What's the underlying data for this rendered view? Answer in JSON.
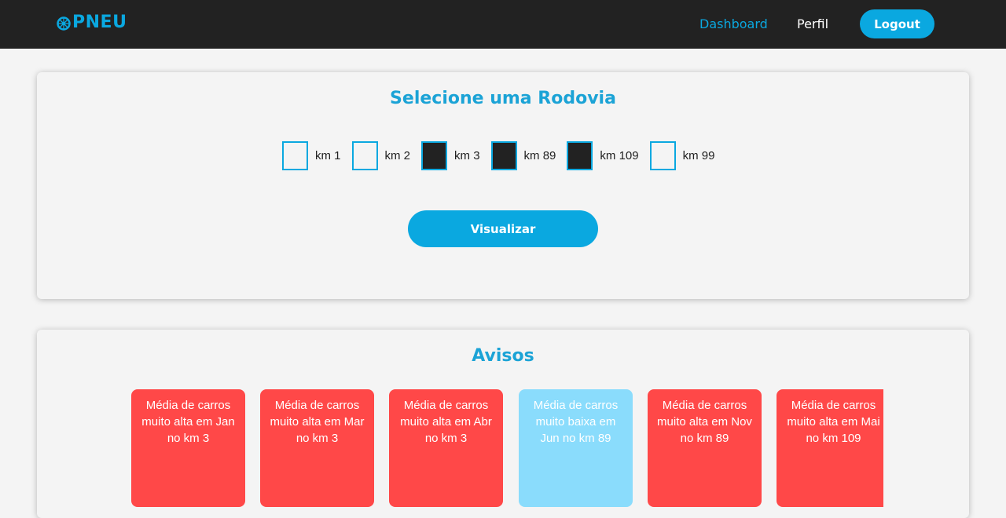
{
  "navbar": {
    "brand": "PNEU",
    "brand_icon": "wheel-icon",
    "links": [
      {
        "label": "Dashboard",
        "active": true
      },
      {
        "label": "Perfil",
        "active": false
      }
    ],
    "logout_label": "Logout"
  },
  "colors": {
    "accent": "#0aa8e0",
    "navbar": "#222222",
    "alert_high": "#ff4848",
    "alert_low": "#8adcfc"
  },
  "rodovia": {
    "title": "Selecione uma Rodovia",
    "options": [
      {
        "label": "km 1",
        "checked": false
      },
      {
        "label": "km 2",
        "checked": false
      },
      {
        "label": "km 3",
        "checked": true
      },
      {
        "label": "km 89",
        "checked": true
      },
      {
        "label": "km 109",
        "checked": true
      },
      {
        "label": "km 99",
        "checked": false
      }
    ],
    "button_label": "Visualizar"
  },
  "avisos": {
    "title": "Avisos",
    "items": [
      {
        "text": "Média de carros muito alta em Jan no km 3",
        "level": "high"
      },
      {
        "text": "Média de carros muito alta em Mar no km 3",
        "level": "high"
      },
      {
        "text": "Média de carros muito alta em Abr no km 3",
        "level": "high"
      },
      {
        "text": "Média de carros muito baixa em Jun no km 89",
        "level": "low"
      },
      {
        "text": "Média de carros muito alta em Nov no km 89",
        "level": "high"
      },
      {
        "text": "Média de carros muito alta em Mai no km 109",
        "level": "high"
      }
    ]
  }
}
